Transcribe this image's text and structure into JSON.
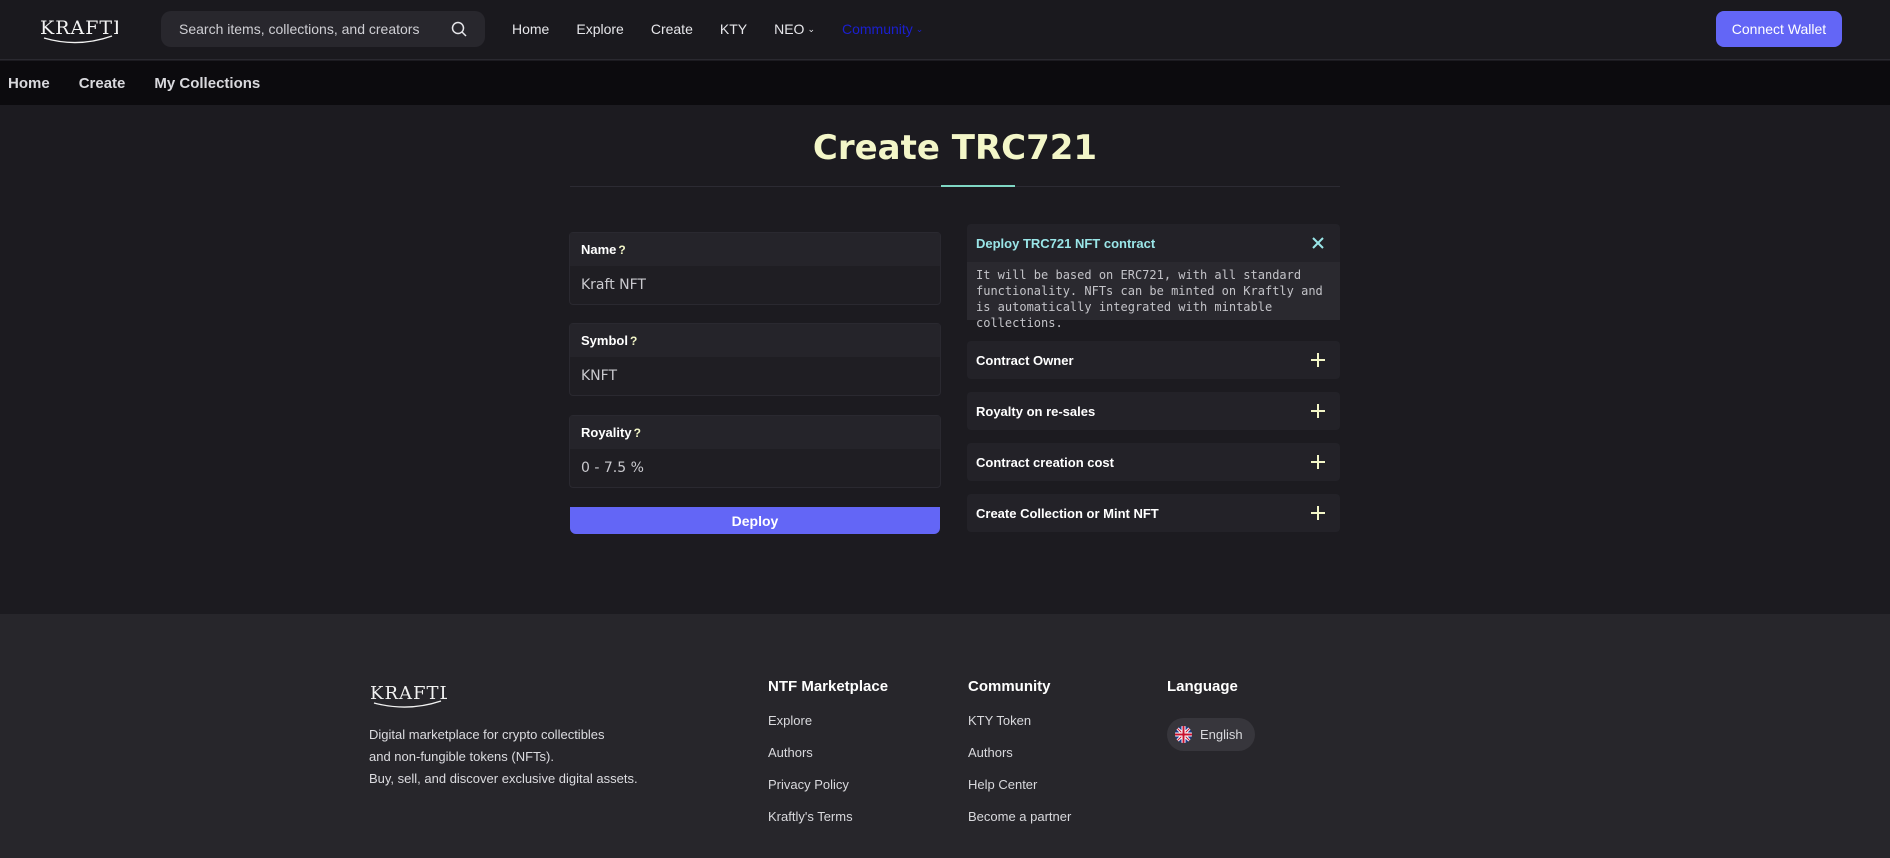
{
  "header": {
    "logo_text": "KRAFTLY",
    "search_placeholder": "Search items, collections, and creators",
    "nav": [
      {
        "label": "Home"
      },
      {
        "label": "Explore"
      },
      {
        "label": "Create"
      },
      {
        "label": "KTY"
      },
      {
        "label": "NEO",
        "has_dropdown": true
      },
      {
        "label": "Community",
        "has_dropdown": true,
        "active": true
      }
    ],
    "connect_label": "Connect Wallet"
  },
  "subnav": [
    "Home",
    "Create",
    "My Collections"
  ],
  "page": {
    "title": "Create TRC721"
  },
  "form": {
    "name_label": "Name",
    "name_value": "Kraft NFT",
    "symbol_label": "Symbol",
    "symbol_value": "KNFT",
    "royalty_label": "Royality",
    "royalty_placeholder": "0 - 7.5 %",
    "deploy_label": "Deploy"
  },
  "info": {
    "open_title": "Deploy TRC721 NFT contract",
    "open_body": "It will be based on ERC721, with all standard functionality. NFTs can be minted on Kraftly and is automatically integrated with mintable collections.",
    "items": [
      "Contract Owner",
      "Royalty on re-sales",
      "Contract creation cost",
      "Create Collection or Mint NFT"
    ]
  },
  "footer": {
    "logo_text": "KRAFTLY",
    "desc": [
      "Digital marketplace for crypto collectibles",
      "and non-fungible tokens (NFTs).",
      "Buy, sell, and discover exclusive digital assets."
    ],
    "marketplace_title": "NTF Marketplace",
    "marketplace_links": [
      "Explore",
      "Authors",
      "Privacy Policy",
      "Kraftly's Terms"
    ],
    "community_title": "Community",
    "community_links": [
      "KTY Token",
      "Authors",
      "Help Center",
      "Become a partner"
    ],
    "language_title": "Language",
    "language_value": "English"
  },
  "colors": {
    "accent": "#6366f6",
    "title": "#f3f6c8",
    "open_accordion": "#9ae6e8",
    "community_link": "#1a1fd0"
  }
}
